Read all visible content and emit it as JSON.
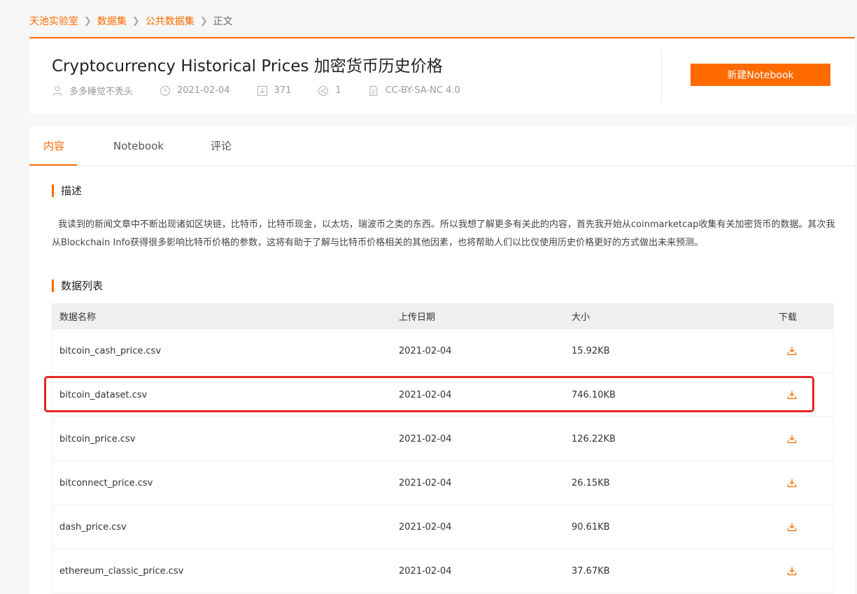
{
  "breadcrumb": {
    "items": [
      "天池实验室",
      "数据集",
      "公共数据集"
    ],
    "current": "正文"
  },
  "header": {
    "title": "Cryptocurrency Historical Prices 加密货币历史价格",
    "author": "多多睡觉不秃头",
    "date": "2021-02-04",
    "downloads": "371",
    "shares": "1",
    "license": "CC-BY-SA-NC 4.0",
    "new_button": "新建Notebook"
  },
  "tabs": [
    {
      "label": "内容",
      "active": true
    },
    {
      "label": "Notebook",
      "active": false
    },
    {
      "label": "评论",
      "active": false
    }
  ],
  "description": {
    "title": "描述",
    "text": "我读到的新闻文章中不断出现诸如区块链，比特币，比特币现金，以太坊，瑞波币之类的东西。所以我想了解更多有关此的内容，首先我开始从coinmarketcap收集有关加密货币的数据。其次我从Blockchain Info获得很多影响比特币价格的参数，这将有助于了解与比特币价格相关的其他因素，也将帮助人们以比仅使用历史价格更好的方式做出未来预测。"
  },
  "datalist": {
    "title": "数据列表",
    "headers": {
      "name": "数据名称",
      "date": "上传日期",
      "size": "大小",
      "download": "下载"
    },
    "rows": [
      {
        "name": "bitcoin_cash_price.csv",
        "date": "2021-02-04",
        "size": "15.92KB"
      },
      {
        "name": "bitcoin_dataset.csv",
        "date": "2021-02-04",
        "size": "746.10KB"
      },
      {
        "name": "bitcoin_price.csv",
        "date": "2021-02-04",
        "size": "126.22KB"
      },
      {
        "name": "bitconnect_price.csv",
        "date": "2021-02-04",
        "size": "26.15KB"
      },
      {
        "name": "dash_price.csv",
        "date": "2021-02-04",
        "size": "90.61KB"
      },
      {
        "name": "ethereum_classic_price.csv",
        "date": "2021-02-04",
        "size": "37.67KB"
      }
    ]
  },
  "colors": {
    "accent": "#ff6a00",
    "highlight": "#e62424"
  }
}
